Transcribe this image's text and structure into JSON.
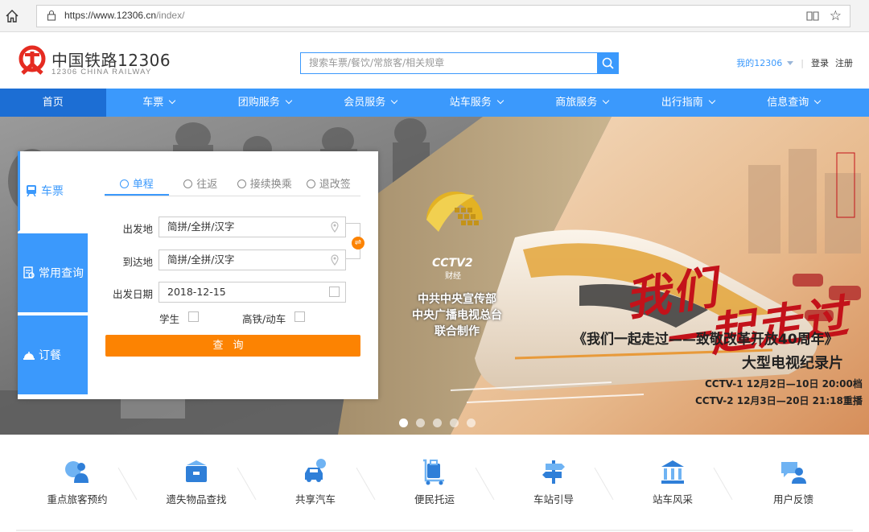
{
  "browser": {
    "url_host": "https://www.12306.cn",
    "url_path": "/index/"
  },
  "header": {
    "logo_title": "中国铁路12306",
    "logo_subtitle": "12306 CHINA RAILWAY",
    "search_placeholder": "搜索车票/餐饮/常旅客/相关规章",
    "my_account": "我的12306",
    "login": "登录",
    "register": "注册"
  },
  "nav": {
    "items": [
      {
        "label": "首页",
        "dropdown": false,
        "active": true
      },
      {
        "label": "车票",
        "dropdown": true
      },
      {
        "label": "团购服务",
        "dropdown": true
      },
      {
        "label": "会员服务",
        "dropdown": true
      },
      {
        "label": "站车服务",
        "dropdown": true
      },
      {
        "label": "商旅服务",
        "dropdown": true
      },
      {
        "label": "出行指南",
        "dropdown": true
      },
      {
        "label": "信息查询",
        "dropdown": true
      }
    ]
  },
  "booking": {
    "side_tabs": [
      {
        "label": "车票",
        "active": true
      },
      {
        "label": "常用查询"
      },
      {
        "label": "订餐"
      }
    ],
    "trip_tabs": [
      {
        "label": "单程",
        "active": true
      },
      {
        "label": "往返"
      },
      {
        "label": "接续换乘"
      },
      {
        "label": "退改签"
      }
    ],
    "from_label": "出发地",
    "from_placeholder": "简拼/全拼/汉字",
    "to_label": "到达地",
    "to_placeholder": "简拼/全拼/汉字",
    "date_label": "出发日期",
    "date_value": "2018-12-15",
    "student_label": "学生",
    "highspeed_label": "高铁/动车",
    "query_button": "查询"
  },
  "banner": {
    "cctv_logo_text": "CCTV2",
    "cctv_channel": "财经",
    "producer_lines": [
      "中共中央宣传部",
      "中央广播电视总台",
      "联合制作"
    ],
    "calligraphy_line1": "我们",
    "calligraphy_line2": "一起走过",
    "doc_title": "《我们一起走过——致敬改革开放40周年》",
    "doc_subtitle": "大型电视纪录片",
    "schedule_1": "CCTV-1  12月2日—10日 20:00档",
    "schedule_2": "CCTV-2  12月3日—20日 21:18重播",
    "slide_count": 5,
    "active_slide": 1
  },
  "services": [
    {
      "label": "重点旅客预约",
      "icon": "wheelchair-passenger-icon"
    },
    {
      "label": "遗失物品查找",
      "icon": "lost-item-box-icon"
    },
    {
      "label": "共享汽车",
      "icon": "shared-car-icon"
    },
    {
      "label": "便民托运",
      "icon": "luggage-cart-icon"
    },
    {
      "label": "车站引导",
      "icon": "signpost-icon"
    },
    {
      "label": "站车风采",
      "icon": "building-icon"
    },
    {
      "label": "用户反馈",
      "icon": "feedback-user-icon"
    }
  ],
  "colors": {
    "primary": "#3b99fc",
    "nav_active": "#1c6ed4",
    "accent_orange": "#fc8302",
    "logo_red": "#e52b21"
  }
}
